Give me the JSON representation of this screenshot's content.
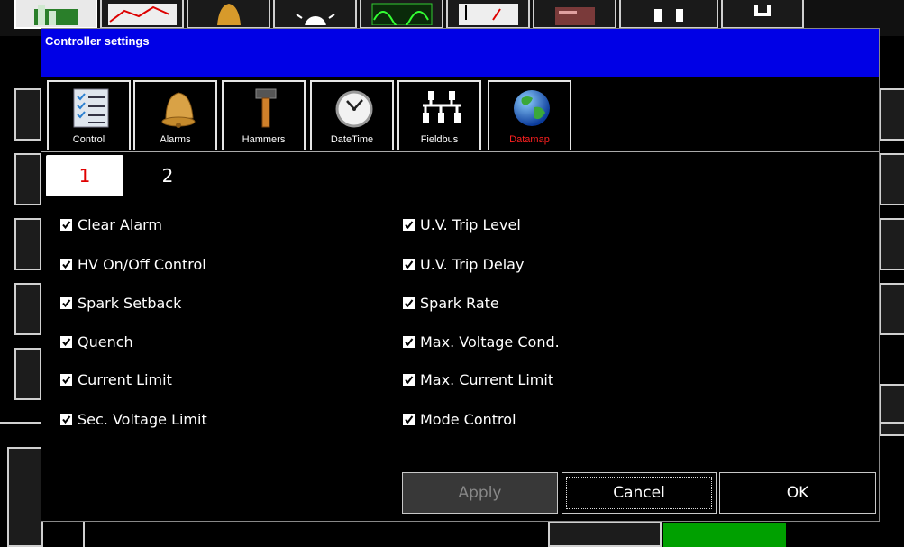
{
  "dialog": {
    "title": "Controller settings"
  },
  "tabs": [
    {
      "label": "Control",
      "icon": "checklist-icon"
    },
    {
      "label": "Alarms",
      "icon": "bell-icon"
    },
    {
      "label": "Hammers",
      "icon": "hammer-icon"
    },
    {
      "label": "DateTime",
      "icon": "clock-icon"
    },
    {
      "label": "Fieldbus",
      "icon": "network-icon"
    },
    {
      "label": "Datamap",
      "icon": "globe-icon",
      "active": true
    }
  ],
  "pages": [
    {
      "label": "1",
      "active": true
    },
    {
      "label": "2",
      "active": false
    }
  ],
  "checkboxes_left": [
    {
      "label": "Clear Alarm",
      "checked": true
    },
    {
      "label": "HV On/Off Control",
      "checked": true
    },
    {
      "label": "Spark Setback",
      "checked": true
    },
    {
      "label": "Quench",
      "checked": true
    },
    {
      "label": "Current Limit",
      "checked": true
    },
    {
      "label": "Sec. Voltage Limit",
      "checked": true
    }
  ],
  "checkboxes_right": [
    {
      "label": "U.V. Trip Level",
      "checked": true
    },
    {
      "label": "U.V. Trip Delay",
      "checked": true
    },
    {
      "label": "Spark Rate",
      "checked": true
    },
    {
      "label": "Max. Voltage Cond.",
      "checked": true
    },
    {
      "label": "Max. Current Limit",
      "checked": true
    },
    {
      "label": "Mode Control",
      "checked": true
    }
  ],
  "buttons": {
    "apply": "Apply",
    "cancel": "Cancel",
    "ok": "OK"
  },
  "colors": {
    "title_bar": "#0000e6",
    "active_text": "#ff2020",
    "background": "#000000",
    "status_green": "#00a000"
  }
}
